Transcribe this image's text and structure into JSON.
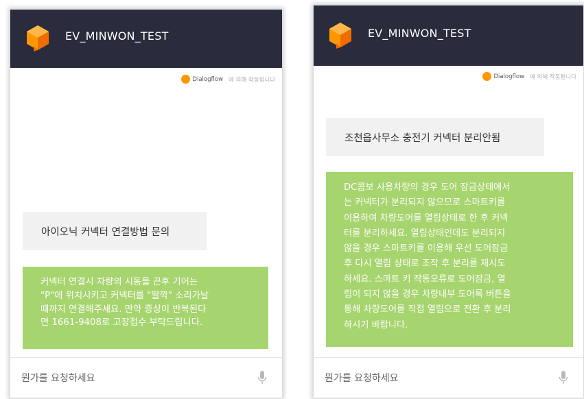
{
  "panels": [
    {
      "title": "EV_MINWON_TEST",
      "powered_brand": "Dialogflow",
      "powered_suffix": "에 의해 작동됩니다",
      "user_message": "아이오닉 커넥터 연결방법 문의",
      "bot_message": "커넥터 연결시 차량의 시동을 끈후 기어는\n\"P\"에 위치시키고 커넥터를 \"딸깍\" 소리가날\n때까지 연결해주세요. 만약 증상이 반복된다\n면 1661-9408로 고장접수 부탁드립니다.",
      "input_placeholder": "뭔가를 요청하세요"
    },
    {
      "title": "EV_MINWON_TEST",
      "powered_brand": "Dialogflow",
      "powered_suffix": "에 의해 작동됩니다",
      "user_message": "조천읍사무소 충전기 커넥터 분리안됨",
      "bot_message": "DC콤보 사용차량의 경우 도어 잠금상태에서\n는 커넥터가 분리되지 않으므로 스마트키를\n이용하여 차량도어를 열림상태로 한 후 커넥\n터를 분리하세요. 열림상태인데도 분리되지\n않을 경우 스마트키를 이용해 우선 도어잠금\n후 다시 열림 상태로 조작 후 분리를 재시도\n하세요. 스마트 키 작동오류로 도어잠금, 열\n림이 되지 않을 경우 차량내부 도어록 버튼을\n통해 차량도어를 직접 열림으로 전환 후 분리\n하시기 바랍니다.",
      "input_placeholder": "뭔가를 요청하세요"
    }
  ],
  "colors": {
    "header_bg": "#2a2b3c",
    "user_bubble_bg": "#f1f1f1",
    "bot_bubble_bg": "#a6d46e",
    "logo_orange": "#ff9800"
  },
  "icons": {
    "logo": "dialogflow-logo-icon",
    "mic": "microphone-icon"
  }
}
